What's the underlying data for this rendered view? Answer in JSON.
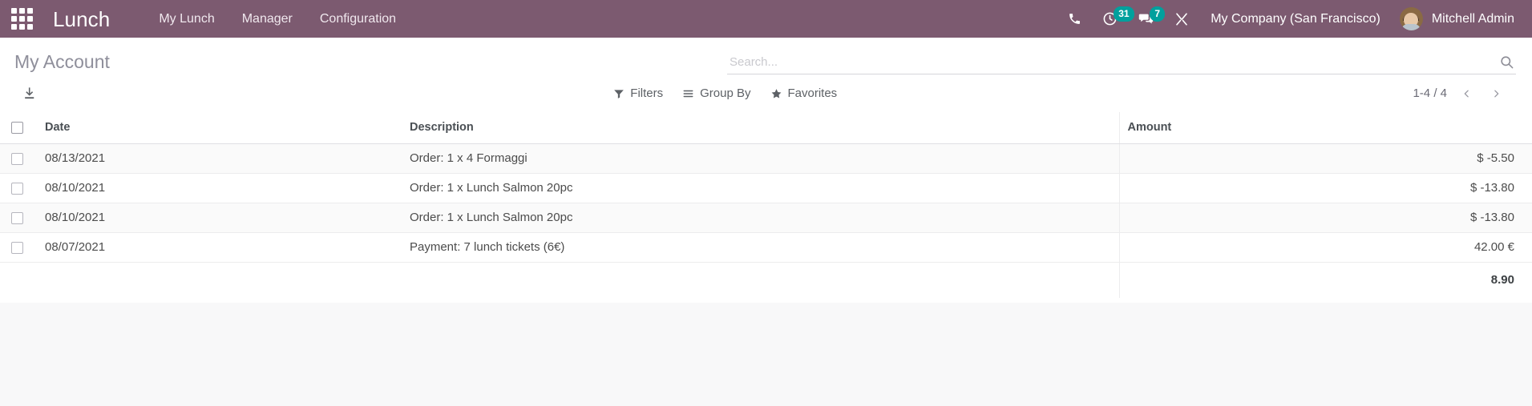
{
  "navbar": {
    "apps_icon": "apps-grid-icon",
    "brand": "Lunch",
    "menu_items": [
      {
        "label": "My Lunch",
        "name": "menu-my-lunch"
      },
      {
        "label": "Manager",
        "name": "menu-manager"
      },
      {
        "label": "Configuration",
        "name": "menu-configuration"
      }
    ],
    "systray": {
      "phone_icon": "phone-icon",
      "activity_icon": "activity-clock-icon",
      "activity_count": "31",
      "messaging_icon": "messaging-chat-icon",
      "messaging_count": "7",
      "lunch_icon": "utensils-icon"
    },
    "company": "My Company (San Francisco)",
    "user": "Mitchell Admin",
    "avatar_name": "user-avatar",
    "background_color": "#7c5a70",
    "badge_color": "#00a09d"
  },
  "control_panel": {
    "page_title": "My Account",
    "search": {
      "placeholder": "Search...",
      "value": "",
      "search_icon": "search-magnifier-icon"
    },
    "export_icon": "download-export-icon",
    "filter_menus": [
      {
        "label": "Filters",
        "icon": "filter-funnel-icon",
        "name": "filters-menu"
      },
      {
        "label": "Group By",
        "icon": "group-by-list-icon",
        "name": "group-by-menu"
      },
      {
        "label": "Favorites",
        "icon": "favorites-star-icon",
        "name": "favorites-menu"
      }
    ],
    "pager": {
      "value": "1-4 / 4",
      "previous_icon": "chevron-left-icon",
      "next_icon": "chevron-right-icon"
    }
  },
  "list": {
    "columns": [
      {
        "key": "date",
        "label": "Date"
      },
      {
        "key": "description",
        "label": "Description"
      },
      {
        "key": "amount",
        "label": "Amount"
      }
    ],
    "rows": [
      {
        "date": "08/13/2021",
        "description": "Order: 1 x 4 Formaggi",
        "amount": "$ -5.50"
      },
      {
        "date": "08/10/2021",
        "description": "Order: 1 x Lunch Salmon 20pc",
        "amount": "$ -13.80"
      },
      {
        "date": "08/10/2021",
        "description": "Order: 1 x Lunch Salmon 20pc",
        "amount": "$ -13.80"
      },
      {
        "date": "08/07/2021",
        "description": "Payment: 7 lunch tickets (6€)",
        "amount": "42.00 €"
      }
    ],
    "footer": {
      "date": "",
      "description": "",
      "amount": "8.90"
    }
  }
}
